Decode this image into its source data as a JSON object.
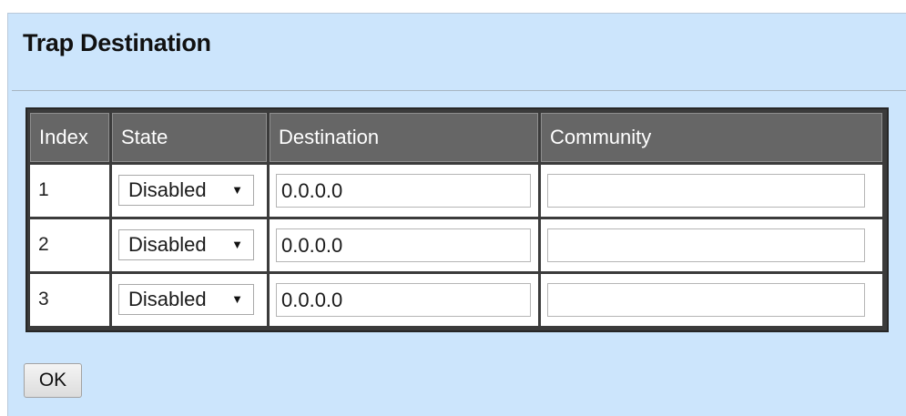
{
  "page": {
    "title": "Trap Destination"
  },
  "table": {
    "headers": [
      "Index",
      "State",
      "Destination",
      "Community"
    ],
    "rows": [
      {
        "index": "1",
        "state": "Disabled",
        "destination": "0.0.0.0",
        "community": ""
      },
      {
        "index": "2",
        "state": "Disabled",
        "destination": "0.0.0.0",
        "community": ""
      },
      {
        "index": "3",
        "state": "Disabled",
        "destination": "0.0.0.0",
        "community": ""
      }
    ]
  },
  "actions": {
    "ok_label": "OK"
  },
  "icons": {
    "dropdown": "chevron-down-icon"
  },
  "colors": {
    "panel_background": "#cce5fc",
    "header_background": "#666666",
    "grid_border": "#3b3b3b"
  }
}
